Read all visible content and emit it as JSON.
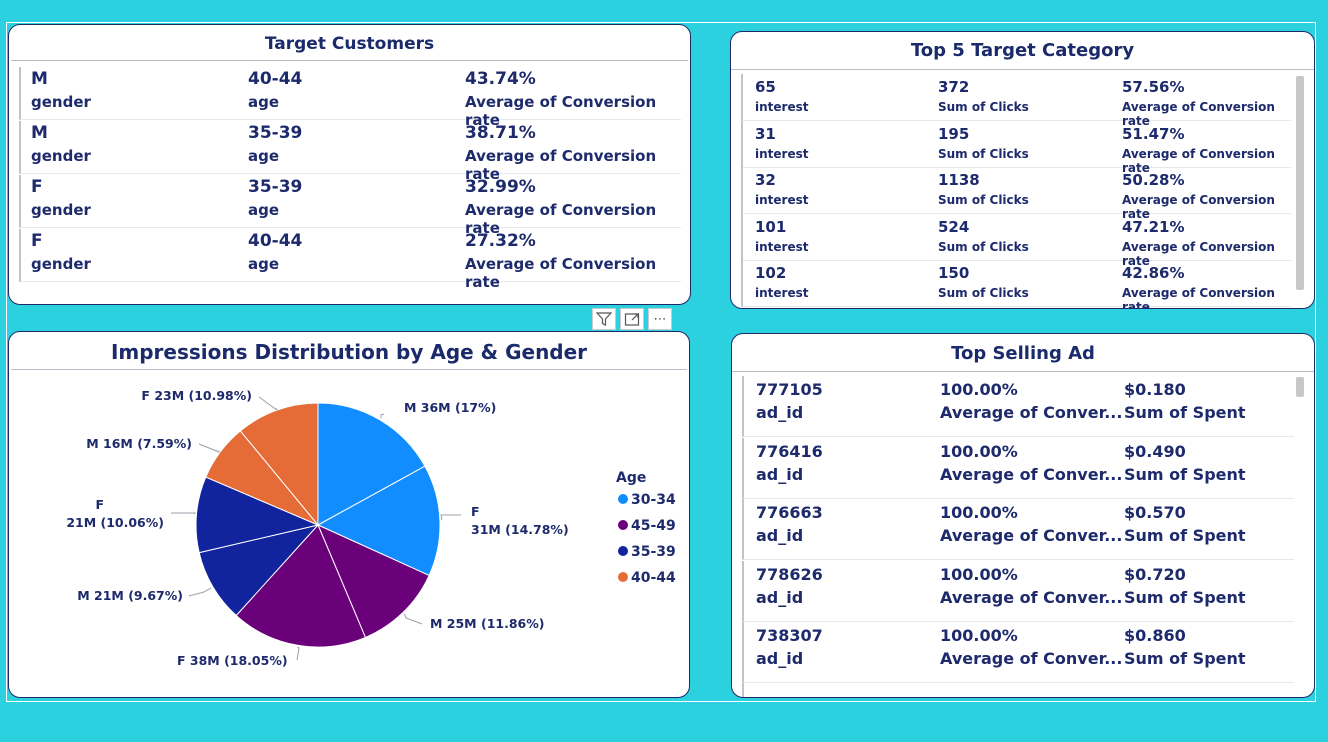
{
  "target_customers": {
    "title": "Target Customers",
    "rows": [
      {
        "gender": "M",
        "gender_label": "gender",
        "age": "40-44",
        "age_label": "age",
        "rate": "43.74%",
        "rate_label": "Average of Conversion rate"
      },
      {
        "gender": "M",
        "gender_label": "gender",
        "age": "35-39",
        "age_label": "age",
        "rate": "38.71%",
        "rate_label": "Average of Conversion rate"
      },
      {
        "gender": "F",
        "gender_label": "gender",
        "age": "35-39",
        "age_label": "age",
        "rate": "32.99%",
        "rate_label": "Average of Conversion rate"
      },
      {
        "gender": "F",
        "gender_label": "gender",
        "age": "40-44",
        "age_label": "age",
        "rate": "27.32%",
        "rate_label": "Average of Conversion rate"
      }
    ]
  },
  "top5": {
    "title": "Top 5 Target Category",
    "rows": [
      {
        "interest": "65",
        "interest_label": "interest",
        "clicks": "372",
        "clicks_label": "Sum of Clicks",
        "rate": "57.56%",
        "rate_label": "Average of Conversion rate"
      },
      {
        "interest": "31",
        "interest_label": "interest",
        "clicks": "195",
        "clicks_label": "Sum of Clicks",
        "rate": "51.47%",
        "rate_label": "Average of Conversion rate"
      },
      {
        "interest": "32",
        "interest_label": "interest",
        "clicks": "1138",
        "clicks_label": "Sum of Clicks",
        "rate": "50.28%",
        "rate_label": "Average of Conversion rate"
      },
      {
        "interest": "101",
        "interest_label": "interest",
        "clicks": "524",
        "clicks_label": "Sum of Clicks",
        "rate": "47.21%",
        "rate_label": "Average of Conversion rate"
      },
      {
        "interest": "102",
        "interest_label": "interest",
        "clicks": "150",
        "clicks_label": "Sum of Clicks",
        "rate": "42.86%",
        "rate_label": "Average of Conversion rate"
      }
    ]
  },
  "top_selling": {
    "title": "Top Selling Ad",
    "rows": [
      {
        "ad_id": "777105",
        "ad_label": "ad_id",
        "conv": "100.00%",
        "conv_label": "Average of Conver...",
        "spent": "$0.180",
        "spent_label": "Sum of Spent"
      },
      {
        "ad_id": "776416",
        "ad_label": "ad_id",
        "conv": "100.00%",
        "conv_label": "Average of Conver...",
        "spent": "$0.490",
        "spent_label": "Sum of Spent"
      },
      {
        "ad_id": "776663",
        "ad_label": "ad_id",
        "conv": "100.00%",
        "conv_label": "Average of Conver...",
        "spent": "$0.570",
        "spent_label": "Sum of Spent"
      },
      {
        "ad_id": "778626",
        "ad_label": "ad_id",
        "conv": "100.00%",
        "conv_label": "Average of Conver...",
        "spent": "$0.720",
        "spent_label": "Sum of Spent"
      },
      {
        "ad_id": "738307",
        "ad_label": "ad_id",
        "conv": "100.00%",
        "conv_label": "Average of Conver...",
        "spent": "$0.860",
        "spent_label": "Sum of Spent"
      }
    ]
  },
  "toolbar": {
    "filter_icon": "filter-icon",
    "focus_icon": "focus-mode-icon",
    "more_label": "⋯"
  },
  "chart_data": {
    "type": "pie",
    "title": "Impressions Distribution by Age & Gender",
    "legend_title": "Age",
    "legend_position": "right",
    "legend": [
      {
        "name": "30-34",
        "color": "#118dff"
      },
      {
        "name": "45-49",
        "color": "#6b007b"
      },
      {
        "name": "35-39",
        "color": "#12239e"
      },
      {
        "name": "40-44",
        "color": "#e66c37"
      }
    ],
    "slices": [
      {
        "label": "M 36M (17%)",
        "value": 17.0,
        "color": "#118dff"
      },
      {
        "label": "F 31M (14.78%)",
        "value": 14.78,
        "color": "#118dff"
      },
      {
        "label": "M 25M (11.86%)",
        "value": 11.86,
        "color": "#6b007b"
      },
      {
        "label": "F 38M (18.05%)",
        "value": 18.05,
        "color": "#6b007b"
      },
      {
        "label": "M 21M (9.67%)",
        "value": 9.67,
        "color": "#12239e"
      },
      {
        "label": "F 21M (10.06%)",
        "value": 10.06,
        "color": "#12239e"
      },
      {
        "label": "M 16M (7.59%)",
        "value": 7.59,
        "color": "#e66c37"
      },
      {
        "label": "F 23M (10.98%)",
        "value": 10.98,
        "color": "#e66c37"
      }
    ]
  }
}
